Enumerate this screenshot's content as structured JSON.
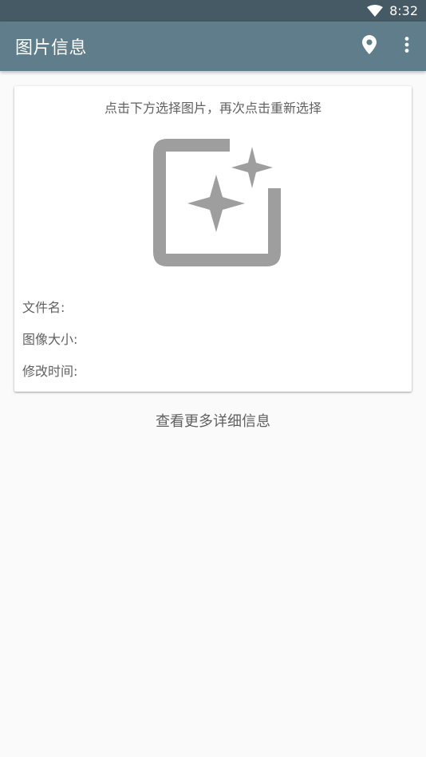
{
  "status_bar": {
    "time": "8:32",
    "wifi_icon": "wifi-icon"
  },
  "app_bar": {
    "title": "图片信息",
    "actions": [
      {
        "icon": "location-pin-icon"
      },
      {
        "icon": "more-vert-icon"
      }
    ],
    "color": "#607d8b"
  },
  "card": {
    "hint": "点击下方选择图片，再次点击重新选择",
    "image_icon": "auto-awesome-image-icon",
    "file_name_label": "文件名:",
    "image_size_label": "图像大小:",
    "modified_time_label": "修改时间:"
  },
  "footer_link": "查看更多详细信息",
  "colors": {
    "status_bar": "#455a64",
    "app_bar": "#607d8b",
    "background": "#fafafa",
    "text_secondary": "#616161",
    "icon_gray": "#9e9e9e"
  }
}
